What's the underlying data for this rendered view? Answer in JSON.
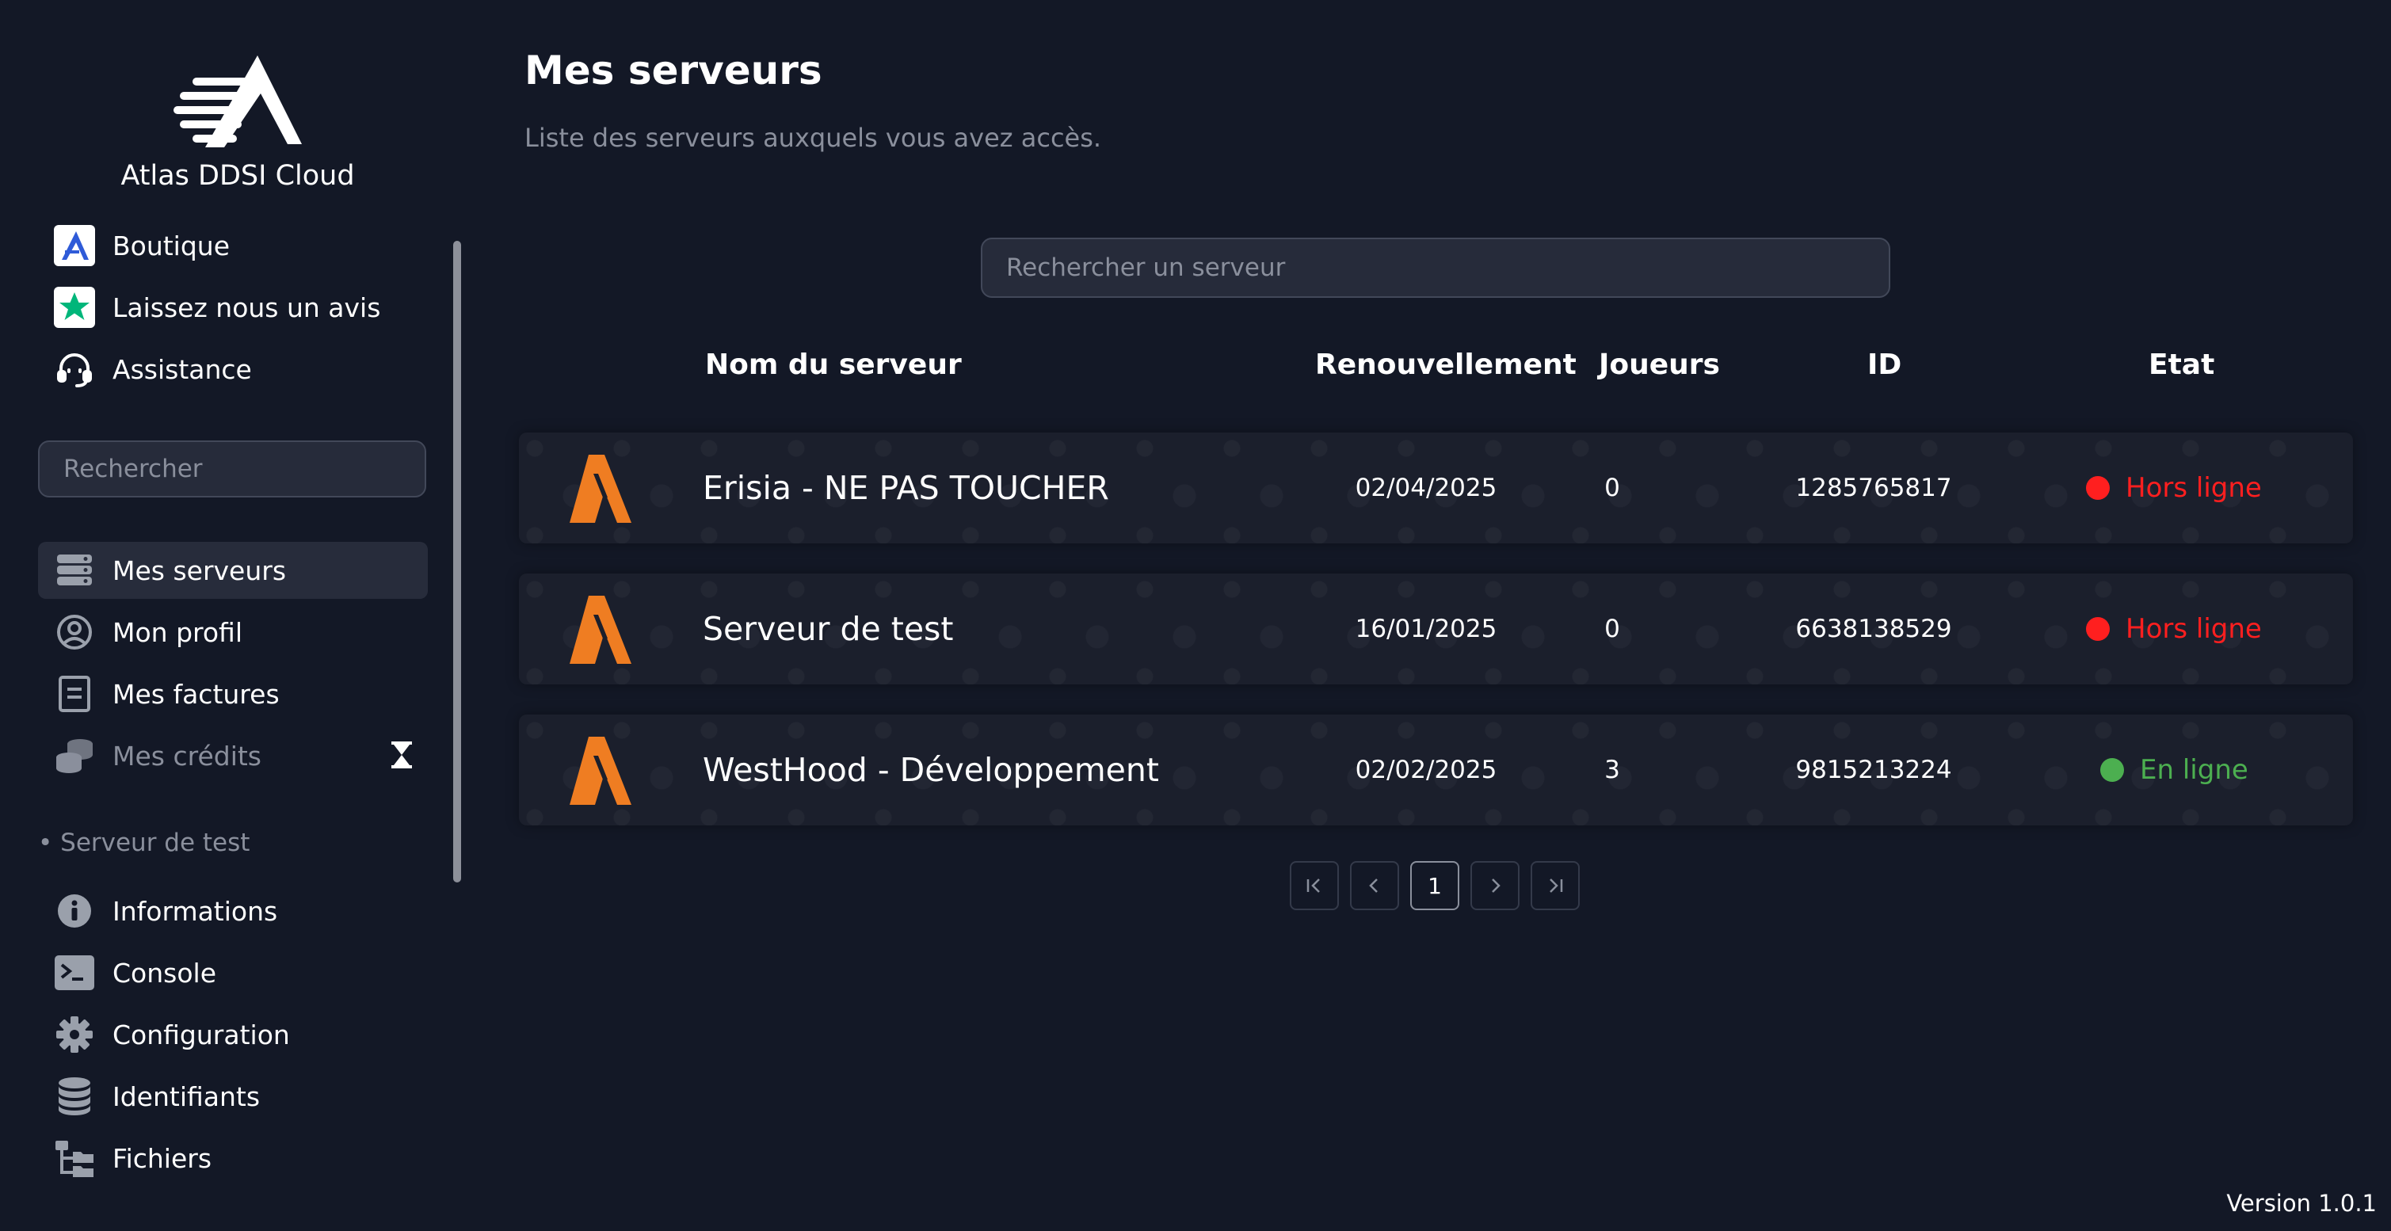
{
  "brand": {
    "name": "Atlas DDSI Cloud"
  },
  "sidebar": {
    "top_links": [
      {
        "label": "Boutique",
        "icon": "atlas-logo-icon"
      },
      {
        "label": "Laissez nous un avis",
        "icon": "trustpilot-star-icon"
      },
      {
        "label": "Assistance",
        "icon": "headset-icon"
      }
    ],
    "search": {
      "placeholder": "Rechercher"
    },
    "main_links": [
      {
        "label": "Mes serveurs",
        "icon": "server-stack-icon",
        "active": true
      },
      {
        "label": "Mon profil",
        "icon": "user-circle-icon"
      },
      {
        "label": "Mes factures",
        "icon": "invoice-icon"
      },
      {
        "label": "Mes crédits",
        "icon": "coins-icon",
        "muted": true,
        "badge_icon": "hourglass-icon"
      }
    ],
    "section_label": "• Serveur de test",
    "server_links": [
      {
        "label": "Informations",
        "icon": "info-icon"
      },
      {
        "label": "Console",
        "icon": "terminal-icon"
      },
      {
        "label": "Configuration",
        "icon": "gear-icon"
      },
      {
        "label": "Identifiants",
        "icon": "database-icon"
      },
      {
        "label": "Fichiers",
        "icon": "folder-tree-icon"
      }
    ]
  },
  "main": {
    "title": "Mes serveurs",
    "subtitle": "Liste des serveurs auxquels vous avez accès.",
    "search": {
      "placeholder": "Rechercher un serveur"
    },
    "table": {
      "headers": {
        "name": "Nom du serveur",
        "renewal": "Renouvellement",
        "players": "Joueurs",
        "id": "ID",
        "state": "Etat"
      },
      "rows": [
        {
          "name": "Erisia - NE PAS TOUCHER",
          "renewal": "02/04/2025",
          "players": "0",
          "id": "1285765817",
          "state": "Hors ligne",
          "online": false
        },
        {
          "name": "Serveur de test",
          "renewal": "16/01/2025",
          "players": "0",
          "id": "6638138529",
          "state": "Hors ligne",
          "online": false
        },
        {
          "name": "WestHood - Développement",
          "renewal": "02/02/2025",
          "players": "3",
          "id": "9815213224",
          "state": "En ligne",
          "online": true
        }
      ]
    },
    "pagination": {
      "current": "1",
      "first_icon": "first-page-icon",
      "prev_icon": "chevron-left-icon",
      "next_icon": "chevron-right-icon",
      "last_icon": "last-page-icon"
    }
  },
  "footer": {
    "version": "Version 1.0.1"
  },
  "colors": {
    "background": "#131826",
    "accent_orange": "#ef7d22",
    "offline_red": "#ff1f1f",
    "online_green": "#4caf50",
    "muted_text": "#8a8f9c"
  }
}
